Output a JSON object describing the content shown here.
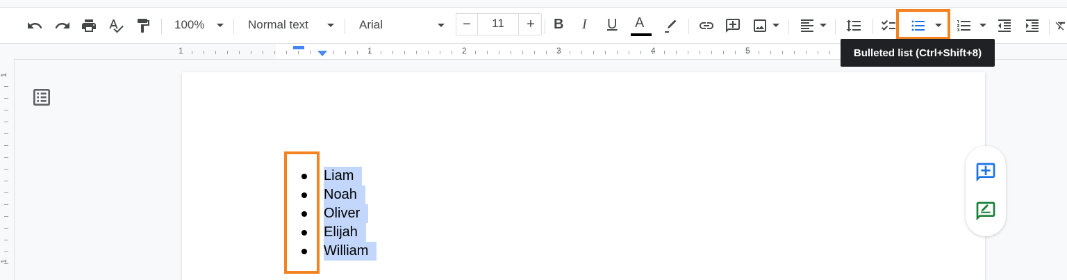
{
  "toolbar": {
    "zoom": "100%",
    "style": "Normal text",
    "font": "Arial",
    "font_size": "11",
    "minus": "−",
    "plus": "+",
    "bold": "B",
    "italic": "I",
    "underline": "U",
    "text_color": "A"
  },
  "tooltip": "Bulleted list (Ctrl+Shift+8)",
  "ruler": {
    "numbers": [
      "1",
      "1",
      "2",
      "3",
      "4",
      "5"
    ]
  },
  "left_ruler_numbers": [
    "1",
    "1"
  ],
  "list_items": [
    "Liam",
    "Noah",
    "Oliver",
    "Elijah",
    "William"
  ],
  "colors": {
    "highlight": "#f58220",
    "selection": "#c2d7fb",
    "accent_blue": "#1a73e8",
    "accent_green": "#188038"
  },
  "icons": {
    "undo": "undo-icon",
    "redo": "redo-icon",
    "print": "print-icon",
    "spellcheck": "spellcheck-icon",
    "paint_format": "paint-format-icon",
    "highlighter": "highlighter-icon",
    "link": "link-icon",
    "comment": "add-comment-icon",
    "image": "insert-image-icon",
    "align": "align-left-icon",
    "line_spacing": "line-spacing-icon",
    "checklist": "checklist-icon",
    "bulleted_list": "bulleted-list-icon",
    "numbered_list": "numbered-list-icon",
    "outdent": "decrease-indent-icon",
    "indent": "increase-indent-icon",
    "clear": "clear-formatting-icon",
    "outline": "document-outline-icon",
    "add_comment_side": "add-comment-icon",
    "suggest_edit": "suggest-edit-icon"
  }
}
